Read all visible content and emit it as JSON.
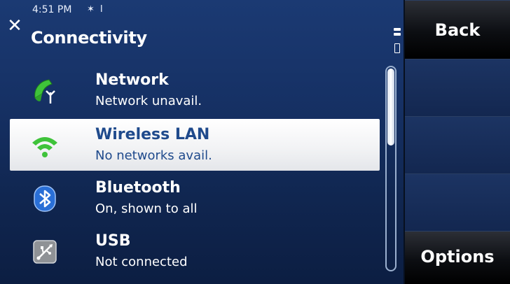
{
  "status_bar": {
    "time": "4:51 PM",
    "icons": "✶ Ι",
    "close_icon": "close-icon"
  },
  "header": {
    "title": "Connectivity"
  },
  "list": {
    "items": [
      {
        "name": "Network",
        "status": "Network unavail.",
        "icon": "phone-antenna-icon",
        "selected": false
      },
      {
        "name": "Wireless LAN",
        "status": "No networks avail.",
        "icon": "wifi-icon",
        "selected": true
      },
      {
        "name": "Bluetooth",
        "status": "On, shown to all",
        "icon": "bluetooth-icon",
        "selected": false
      },
      {
        "name": "USB",
        "status": "Not connected",
        "icon": "usb-icon",
        "selected": false
      }
    ]
  },
  "softkeys": {
    "back": "Back",
    "options": "Options"
  },
  "colors": {
    "background": "#163165",
    "selected_text": "#1f4a8c",
    "wifi_green": "#3fc33a",
    "bluetooth_blue": "#2a6fd6"
  }
}
